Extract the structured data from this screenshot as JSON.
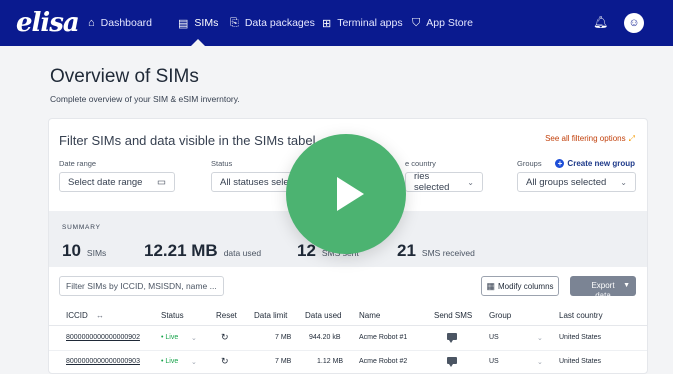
{
  "nav": {
    "logo": "elisa",
    "items": [
      {
        "label": "Dashboard",
        "icon": "home-icon"
      },
      {
        "label": "SIMs",
        "icon": "sim-icon"
      },
      {
        "label": "Data packages",
        "icon": "package-icon"
      },
      {
        "label": "Terminal apps",
        "icon": "grid-icon"
      },
      {
        "label": "App Store",
        "icon": "cart-icon"
      }
    ],
    "active": "SIMs",
    "bell_icon": "bell-icon",
    "avatar_icon": "user-icon"
  },
  "page": {
    "title": "Overview of SIMs",
    "subtitle": "Complete overview of your SIM & eSIM inverntory."
  },
  "filters": {
    "title": "Filter SIMs and data visible in the SIMs tabel",
    "see_all": "See all filtering options",
    "date_range_label": "Date range",
    "date_range_value": "Select date range",
    "status_label": "Status",
    "status_value": "All statuses selec",
    "country_label": "e country",
    "country_value": "ries selected",
    "groups_label": "Groups",
    "create_group": "Create new group",
    "groups_value": "All groups selected"
  },
  "summary": {
    "label": "SUMMARY",
    "sims_count": "10",
    "sims_unit": "SIMs",
    "data_used_value": "12.21 MB",
    "data_used_unit": "data used",
    "sms_sent_value": "12",
    "sms_sent_unit": "SMS sent",
    "sms_received_value": "21",
    "sms_received_unit": "SMS received"
  },
  "toolbar": {
    "search_placeholder": "Filter SIMs by ICCID, MSISDN, name ...",
    "modify_columns": "Modify columns",
    "export": "Export data"
  },
  "table": {
    "headers": {
      "iccid": "ICCID",
      "status": "Status",
      "reset": "Reset",
      "data_limit": "Data limit",
      "data_used": "Data used",
      "name": "Name",
      "send_sms": "Send SMS",
      "group": "Group",
      "last_country": "Last country"
    },
    "rows": [
      {
        "iccid": "8000000000000000902",
        "status": "• Live",
        "data_limit": "7 MB",
        "data_used": "944.20 kB",
        "name": "Acme Robot #1",
        "group": "US",
        "last_country": "United States"
      },
      {
        "iccid": "8000000000000000903",
        "status": "• Live",
        "data_limit": "7 MB",
        "data_used": "1.12 MB",
        "name": "Acme Robot #2",
        "group": "US",
        "last_country": "United States"
      }
    ]
  },
  "colors": {
    "nav_bg": "#0a1a8f",
    "accent_orange": "#c2410c",
    "live_green": "#16a34a",
    "play_green": "#4cb371"
  }
}
